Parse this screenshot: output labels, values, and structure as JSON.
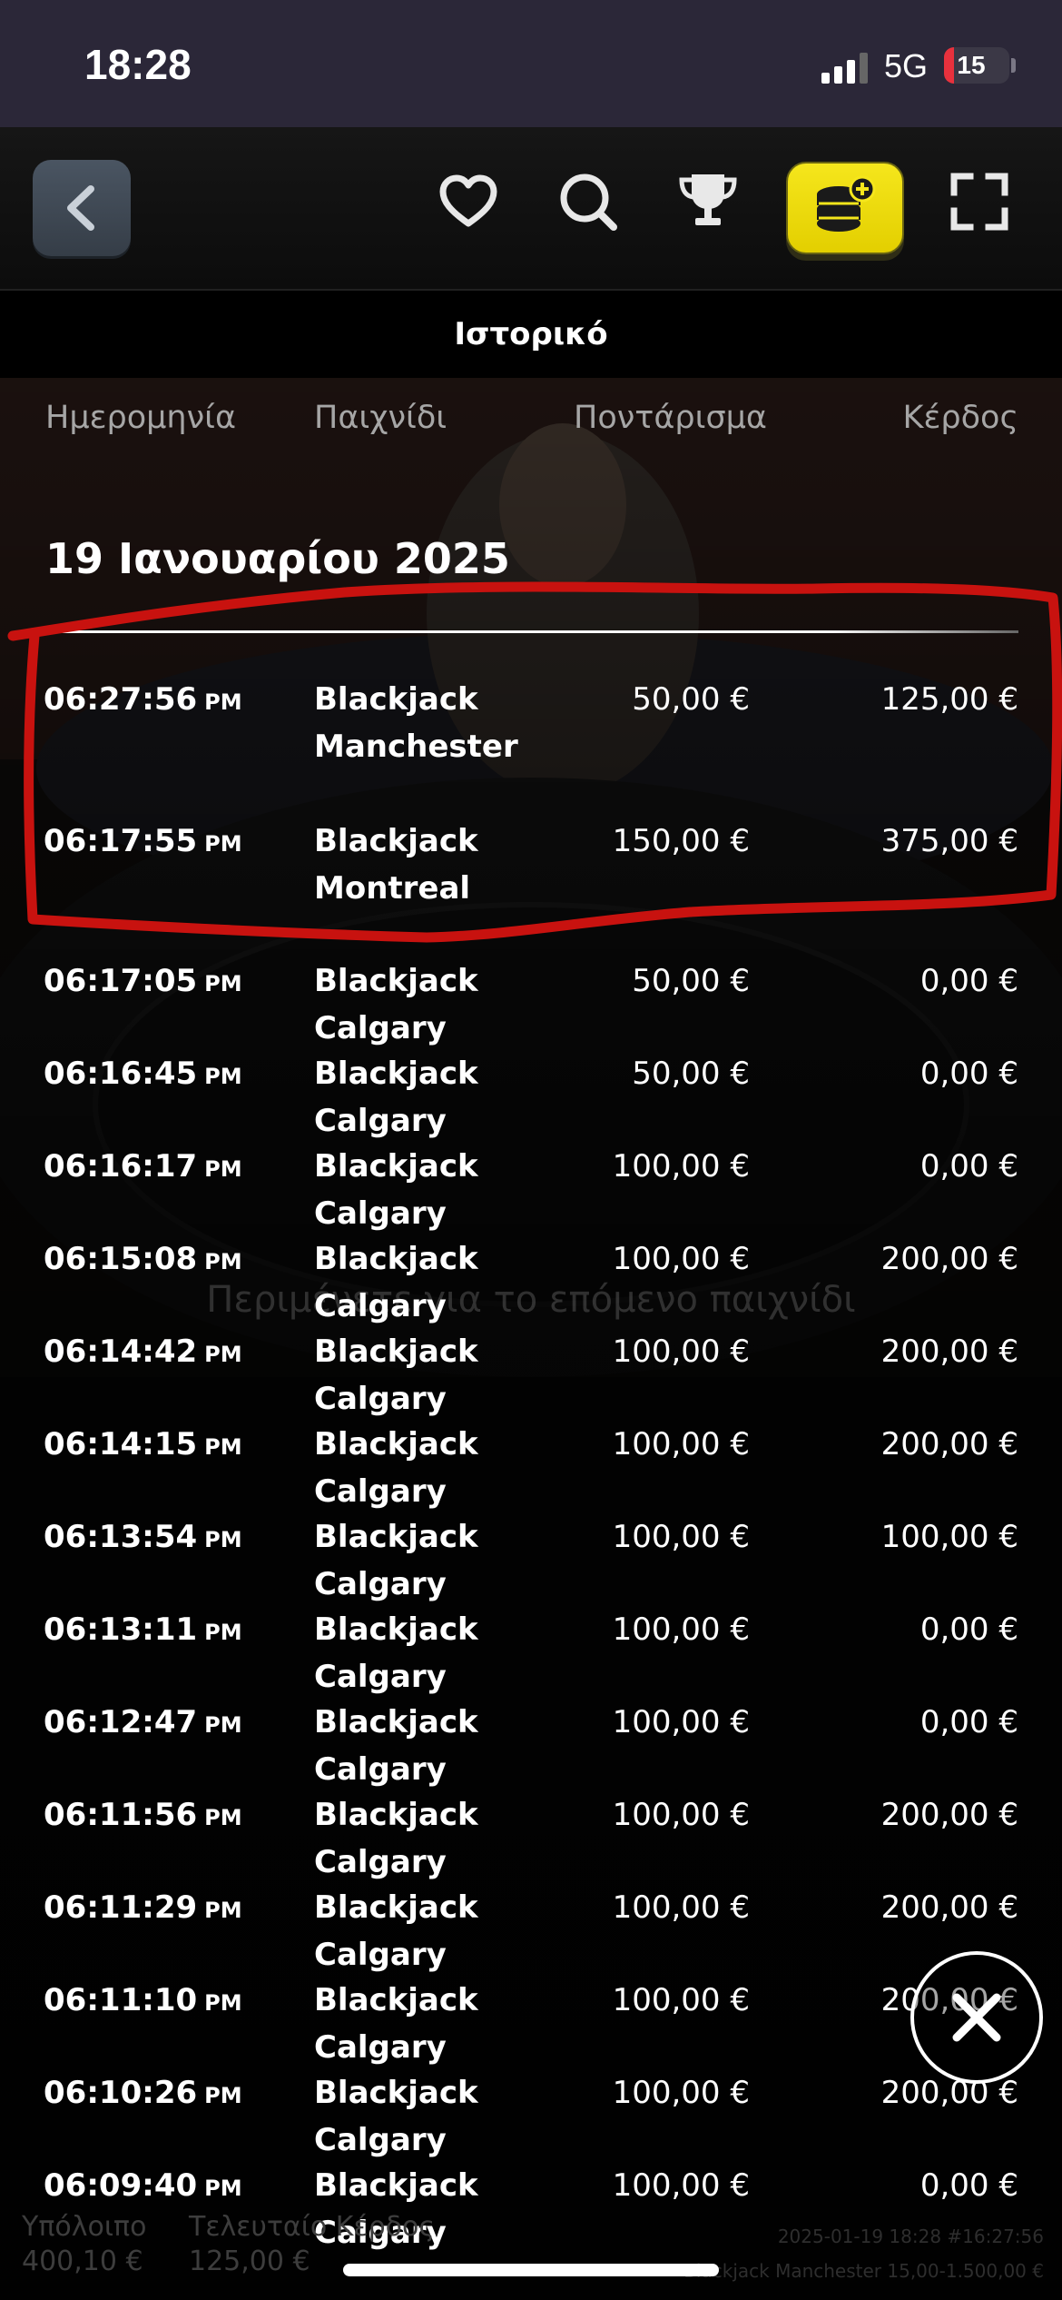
{
  "status_bar": {
    "time": "18:28",
    "network": "5G",
    "battery": "15",
    "battery_level": 0.15,
    "battery_color": "#e8313d"
  },
  "toolbar": {
    "back_icon": "chevron-left-icon",
    "icons": [
      "heart-icon",
      "search-icon",
      "trophy-icon",
      "coins-plus-icon",
      "fullscreen-icon"
    ],
    "cashier_color": "#f5e61c"
  },
  "panel": {
    "title": "Ιστορικό",
    "columns": {
      "date": "Ημερομηνία",
      "game": "Παιχνίδι",
      "stake": "Ποντάρισμα",
      "win": "Κέρδος"
    },
    "date_header": "19 Ιανουαρίου 2025",
    "rows": [
      {
        "time": "06:27:56",
        "ampm": "PM",
        "game": "Blackjack Manchester",
        "stake": "50,00 €",
        "win": "125,00 €"
      },
      {
        "time": "06:17:55",
        "ampm": "PM",
        "game": "Blackjack Montreal",
        "stake": "150,00 €",
        "win": "375,00 €"
      },
      {
        "time": "06:17:05",
        "ampm": "PM",
        "game": "Blackjack Calgary",
        "stake": "50,00 €",
        "win": "0,00 €"
      },
      {
        "time": "06:16:45",
        "ampm": "PM",
        "game": "Blackjack Calgary",
        "stake": "50,00 €",
        "win": "0,00 €"
      },
      {
        "time": "06:16:17",
        "ampm": "PM",
        "game": "Blackjack Calgary",
        "stake": "100,00 €",
        "win": "0,00 €"
      },
      {
        "time": "06:15:08",
        "ampm": "PM",
        "game": "Blackjack Calgary",
        "stake": "100,00 €",
        "win": "200,00 €"
      },
      {
        "time": "06:14:42",
        "ampm": "PM",
        "game": "Blackjack Calgary",
        "stake": "100,00 €",
        "win": "200,00 €"
      },
      {
        "time": "06:14:15",
        "ampm": "PM",
        "game": "Blackjack Calgary",
        "stake": "100,00 €",
        "win": "200,00 €"
      },
      {
        "time": "06:13:54",
        "ampm": "PM",
        "game": "Blackjack Calgary",
        "stake": "100,00 €",
        "win": "100,00 €"
      },
      {
        "time": "06:13:11",
        "ampm": "PM",
        "game": "Blackjack Calgary",
        "stake": "100,00 €",
        "win": "0,00 €"
      },
      {
        "time": "06:12:47",
        "ampm": "PM",
        "game": "Blackjack Calgary",
        "stake": "100,00 €",
        "win": "0,00 €"
      },
      {
        "time": "06:11:56",
        "ampm": "PM",
        "game": "Blackjack Calgary",
        "stake": "100,00 €",
        "win": "200,00 €"
      },
      {
        "time": "06:11:29",
        "ampm": "PM",
        "game": "Blackjack Calgary",
        "stake": "100,00 €",
        "win": "200,00 €"
      },
      {
        "time": "06:11:10",
        "ampm": "PM",
        "game": "Blackjack Calgary",
        "stake": "100,00 €",
        "win": "200,00 €"
      },
      {
        "time": "06:10:26",
        "ampm": "PM",
        "game": "Blackjack Calgary",
        "stake": "100,00 €",
        "win": "200,00 €"
      },
      {
        "time": "06:09:40",
        "ampm": "PM",
        "game": "Blackjack Calgary",
        "stake": "100,00 €",
        "win": "0,00 €"
      }
    ]
  },
  "background_game": {
    "waiting_text": "Περιμένετε για το επόμενο παιχνίδι"
  },
  "footer": {
    "balance_label": "Υπόλοιπο",
    "balance_value": "400,10 €",
    "last_win_label": "Τελευταίο Κέρδος",
    "last_win_value": "125,00 €",
    "round_id": "2025-01-19 18:28 #16:27:56",
    "table_info": "Blackjack Manchester 15,00-1.500,00 €"
  },
  "close_icon": "close-icon",
  "annotation_color": "#c8120f"
}
